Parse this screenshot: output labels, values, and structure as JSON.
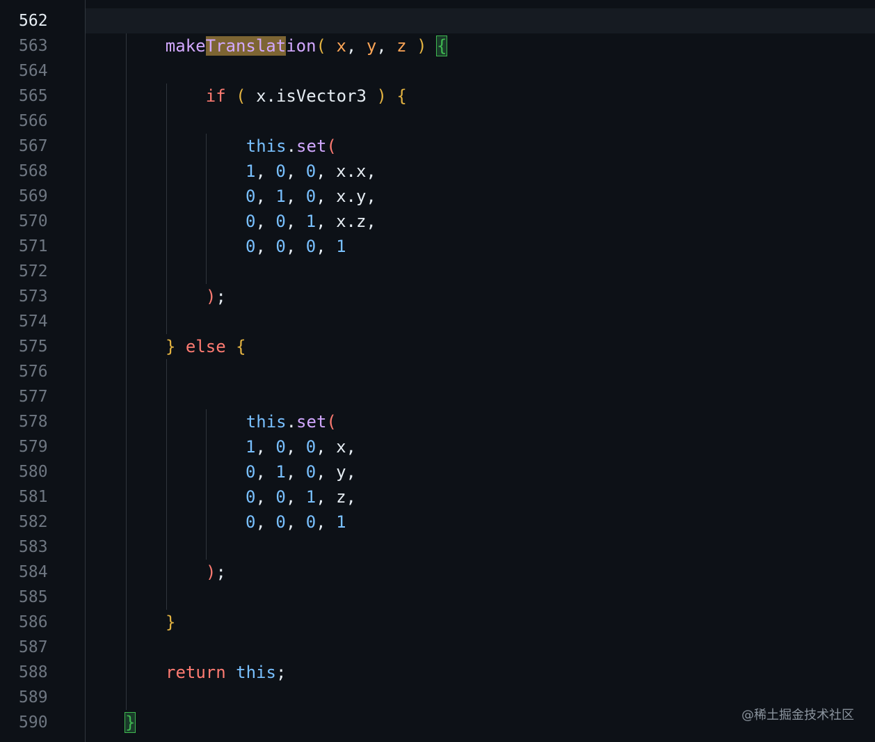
{
  "editor": {
    "line_numbers": [
      "562",
      "563",
      "564",
      "565",
      "566",
      "567",
      "568",
      "569",
      "570",
      "571",
      "572",
      "573",
      "574",
      "575",
      "576",
      "577",
      "578",
      "579",
      "580",
      "581",
      "582",
      "583",
      "584",
      "585",
      "586",
      "587",
      "588",
      "589",
      "590"
    ],
    "active_line": "562"
  },
  "code": {
    "l562": {
      "fn_a": "make",
      "fn_hl": "Translat",
      "fn_b": "ion",
      "open_paren": "( ",
      "p_x": "x",
      "comma1": ", ",
      "p_y": "y",
      "comma2": ", ",
      "p_z": "z",
      "close_paren": " ) ",
      "brace": "{"
    },
    "l564": {
      "kw": "if",
      "open": " ( ",
      "expr": "x.isVector3",
      "close": " ) ",
      "brace": "{"
    },
    "l566": {
      "this": "this",
      "dot": ".",
      "method": "set",
      "paren": "("
    },
    "l568": {
      "a": "1",
      "b": "0",
      "c": "0",
      "d": "x.x,"
    },
    "l569": {
      "a": "0",
      "b": "1",
      "c": "0",
      "d": "x.y,"
    },
    "l570": {
      "a": "0",
      "b": "0",
      "c": "1",
      "d": "x.z,"
    },
    "l571": {
      "a": "0",
      "b": "0",
      "c": "0",
      "d": "1"
    },
    "l573": {
      "close": ")",
      "semi": ";"
    },
    "l575": {
      "brace1": "}",
      "kw": " else ",
      "brace2": "{"
    },
    "l577": {
      "this": "this",
      "dot": ".",
      "method": "set",
      "paren": "("
    },
    "l579": {
      "a": "1",
      "b": "0",
      "c": "0",
      "d": "x,"
    },
    "l580": {
      "a": "0",
      "b": "1",
      "c": "0",
      "d": "y,"
    },
    "l581": {
      "a": "0",
      "b": "0",
      "c": "1",
      "d": "z,"
    },
    "l582": {
      "a": "0",
      "b": "0",
      "c": "0",
      "d": "1"
    },
    "l584": {
      "close": ")",
      "semi": ";"
    },
    "l586": {
      "brace": "}"
    },
    "l588": {
      "kw": "return",
      "this": "this",
      "semi": ";"
    },
    "l590": {
      "brace": "}"
    }
  },
  "watermark": "@稀土掘金技术社区",
  "colors": {
    "background": "#0d1117",
    "function": "#d2a8ff",
    "keyword": "#ff7b72",
    "number": "#79c0ff",
    "parameter": "#ffa657",
    "bracket_match": "#3fb950",
    "search_highlight": "#7d6533"
  }
}
